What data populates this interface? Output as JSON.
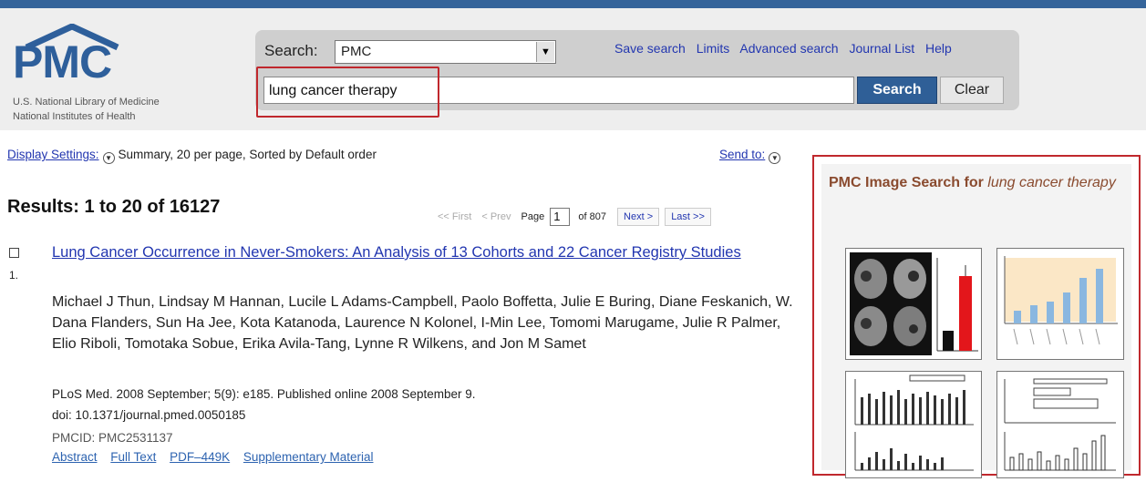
{
  "logo": {
    "text": "PMC",
    "line1": "U.S. National Library of Medicine",
    "line2": "National Institutes of Health"
  },
  "search": {
    "label": "Search:",
    "database": "PMC",
    "query": "lung cancer therapy",
    "search_button": "Search",
    "clear_button": "Clear"
  },
  "top_links": [
    "Save search",
    "Limits",
    "Advanced search",
    "Journal List",
    "Help"
  ],
  "display": {
    "settings_link": "Display Settings:",
    "settings_text": "Summary, 20 per page, Sorted by Default order",
    "send_to": "Send to:"
  },
  "results": {
    "heading": "Results: 1 to 20 of 16127",
    "pager": {
      "first": "<< First",
      "prev": "< Prev",
      "page_label": "Page",
      "page": "1",
      "of": "of 807",
      "next": "Next >",
      "last": "Last >>"
    },
    "items": [
      {
        "number": "1.",
        "title": "Lung Cancer Occurrence in Never-Smokers: An Analysis of 13 Cohorts and 22 Cancer Registry Studies",
        "authors": "Michael J Thun, Lindsay M Hannan, Lucile L Adams-Campbell, Paolo Boffetta, Julie E Buring, Diane Feskanich, W. Dana Flanders, Sun Ha Jee, Kota Katanoda, Laurence N Kolonel, I-Min Lee, Tomomi Marugame, Julie R Palmer, Elio Riboli, Tomotaka Sobue, Erika Avila-Tang, Lynne R Wilkens, and Jon M Samet",
        "citation": "PLoS Med. 2008 September; 5(9): e185. Published online 2008 September 9.",
        "doi": "doi: 10.1371/journal.pmed.0050185",
        "pmcid": "PMCID: PMC2531137",
        "links": [
          "Abstract",
          "Full Text",
          "PDF–449K",
          "Supplementary Material"
        ]
      }
    ]
  },
  "image_search": {
    "title_bold": "PMC Image Search for",
    "title_italic": "lung cancer therapy"
  },
  "colors": {
    "brand_blue": "#2e5f9b",
    "link_blue": "#2236b0",
    "highlight_red": "#c0282d",
    "panel_title_brown": "#8a4b2f"
  }
}
